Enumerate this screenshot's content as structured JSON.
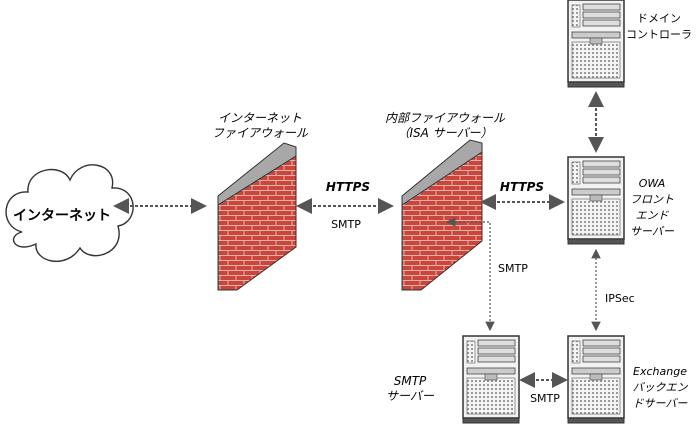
{
  "labels": {
    "internet": "インターネット",
    "external_firewall": [
      "インターネット",
      "ファイアウォール"
    ],
    "internal_firewall": [
      "内部ファイアウォール",
      "（ISA サーバー）"
    ],
    "domain_controller": [
      "ドメイン",
      "コントローラ"
    ],
    "owa_frontend": [
      "OWA",
      "フロント",
      "エンド",
      "サーバー"
    ],
    "exchange_backend": [
      "Exchange",
      "バックエン",
      "ドサーバー"
    ],
    "smtp_server": [
      "SMTP",
      "サーバー"
    ]
  },
  "connections": {
    "https_1": "HTTPS",
    "smtp_1": "SMTP",
    "https_2": "HTTPS",
    "smtp_down": "SMTP",
    "ipsec": "IPSec",
    "smtp_bottom": "SMTP"
  },
  "colors": {
    "brick": "#c8463c",
    "mortar": "#e8b0a8",
    "wall_cap": "#a8a8a8",
    "server_body": "#f2f2f2",
    "arrow": "#555555"
  }
}
